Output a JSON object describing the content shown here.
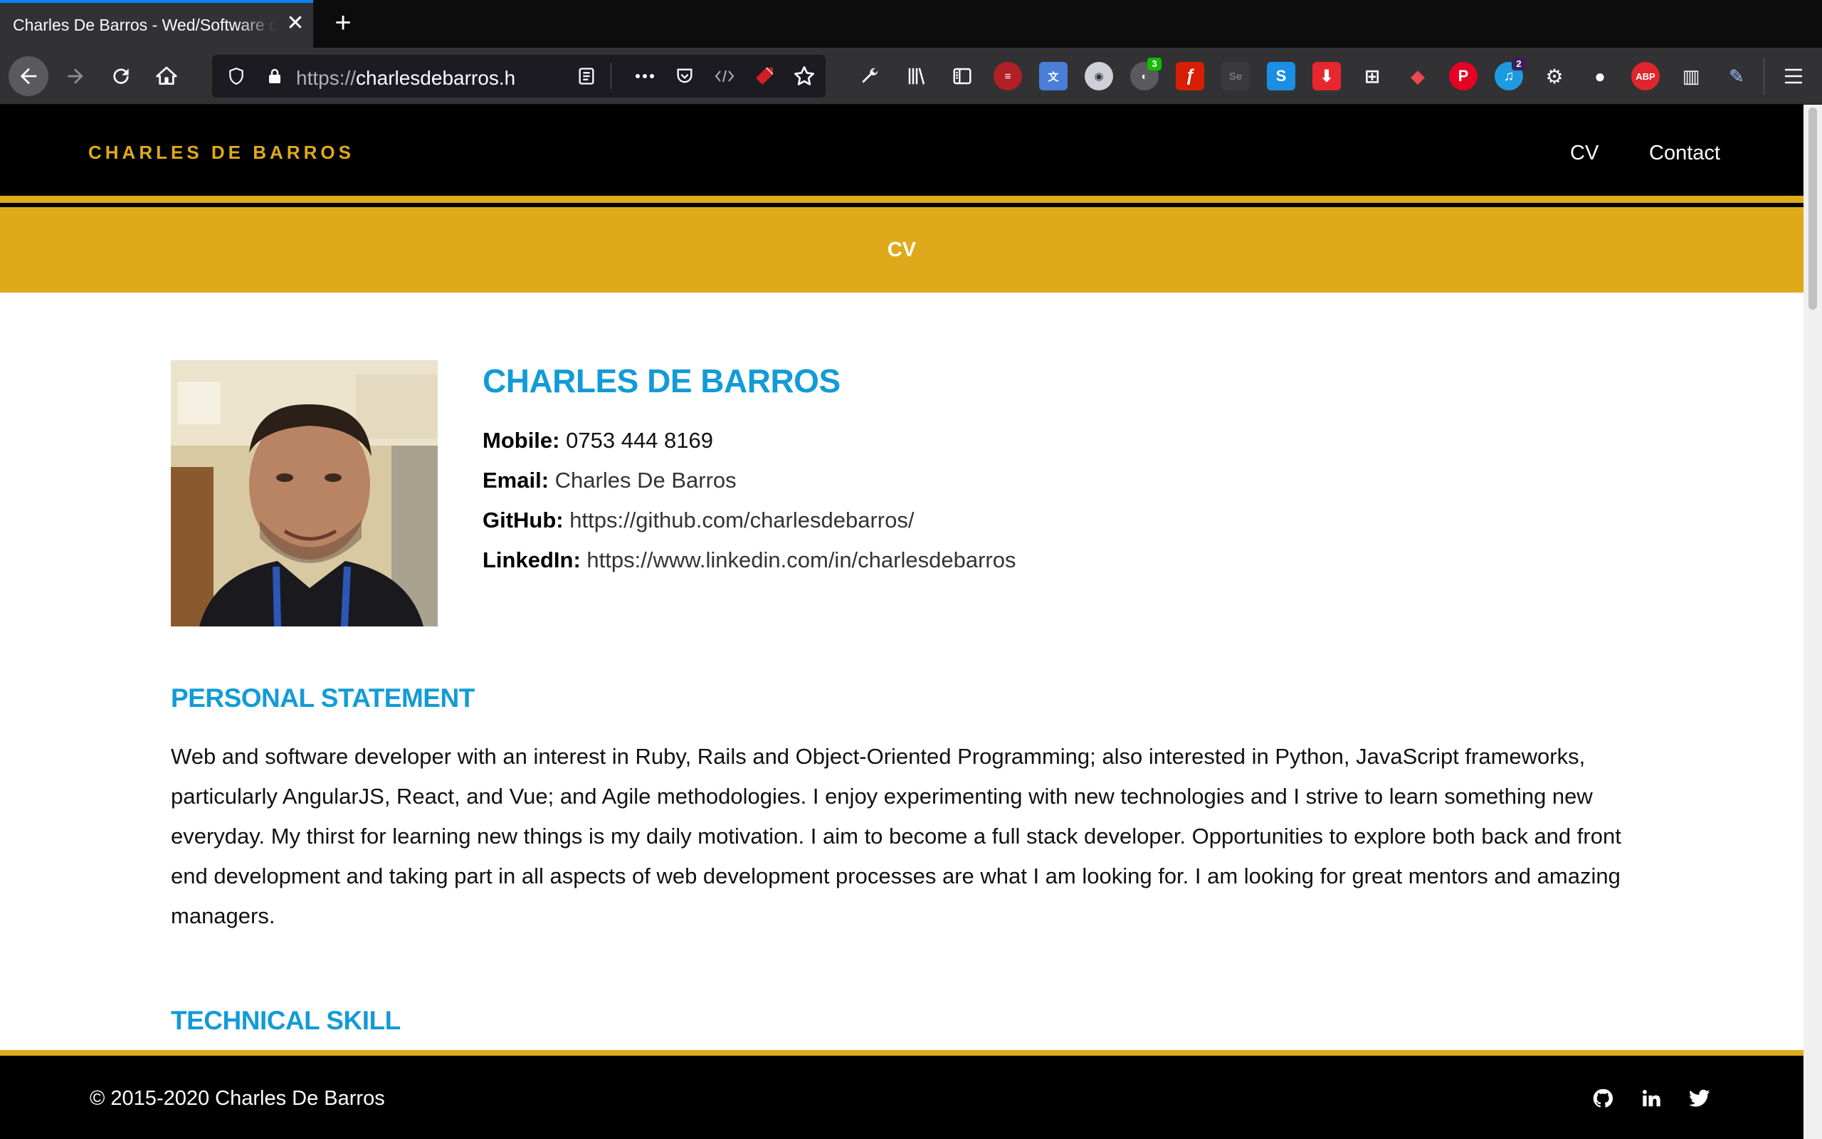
{
  "browser": {
    "tab_title": "Charles De Barros - Wed/Software developer",
    "url_protocol": "https://",
    "url_host": "charlesdebarros.h",
    "extension_badges": {
      "first": "3",
      "second": "2"
    },
    "adblock_label": "ABP",
    "icons": [
      "back-arrow-icon",
      "forward-arrow-icon",
      "reload-icon",
      "home-icon",
      "shield-icon",
      "lock-icon",
      "reader-view-icon",
      "more-icon",
      "pocket-icon",
      "code-icon",
      "ruby-icon",
      "star-icon",
      "wrench-icon",
      "library-icon",
      "sidebar-icon",
      "hamburger-menu-icon"
    ]
  },
  "site": {
    "brand": "CHARLES DE BARROS",
    "nav": {
      "cv": "CV",
      "contact": "Contact"
    },
    "banner_title": "CV"
  },
  "profile": {
    "name": "CHARLES DE BARROS",
    "mobile_label": "Mobile:",
    "mobile_value": "0753 444 8169",
    "email_label": "Email:",
    "email_value": "Charles De Barros",
    "github_label": "GitHub:",
    "github_value": "https://github.com/charlesdebarros/",
    "linkedin_label": "LinkedIn:",
    "linkedin_value": "https://www.linkedin.com/in/charlesdebarros"
  },
  "sections": {
    "personal_statement_heading": "PERSONAL STATEMENT",
    "personal_statement_text": "Web and software developer with an interest in Ruby, Rails and Object-Oriented Programming; also interested in Python, JavaScript frameworks, particularly AngularJS, React, and Vue; and Agile methodologies. I enjoy experimenting with new technologies and I strive to learn something new everyday. My thirst for learning new things is my daily motivation. I aim to become a full stack developer. Opportunities to explore both back and front end development and taking part in all aspects of web development processes are what I am looking for. I am looking for great mentors and amazing managers.",
    "technical_skill_heading": "TECHNICAL SKILL"
  },
  "footer": {
    "copyright": "© 2015-2020 Charles De Barros",
    "social_icons": [
      "github-icon",
      "linkedin-icon",
      "twitter-icon"
    ]
  },
  "colors": {
    "accent_gold": "#deaa1c",
    "heading_blue": "#129bd6",
    "nav_black": "#000000"
  }
}
